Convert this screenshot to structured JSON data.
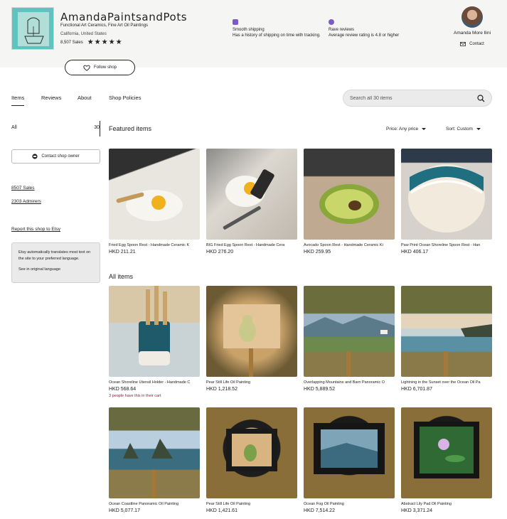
{
  "shop": {
    "name": "AmandaPaintsandPots",
    "tagline": "Functional Art Ceramics, Fine Art Oil Paintings",
    "location": "California, United States",
    "sales": "8,507 Sales",
    "rating": 5
  },
  "features": [
    {
      "title": "Smooth shipping",
      "desc": "Has a history of shipping on time with tracking.",
      "icon": "shipping-truck-icon"
    },
    {
      "title": "Rave reviews",
      "desc": "Average review rating is 4.8 or higher",
      "icon": "rave-badge-icon"
    }
  ],
  "owner": {
    "name": "Amanda More llini",
    "contact_label": "Contact"
  },
  "follow_label": "Follow shop",
  "tabs": [
    {
      "label": "Items",
      "active": true
    },
    {
      "label": "Reviews",
      "active": false
    },
    {
      "label": "About",
      "active": false
    },
    {
      "label": "Shop Policies",
      "active": false
    }
  ],
  "search": {
    "placeholder": "Search all 30 items"
  },
  "sidebar": {
    "all_label": "All",
    "all_count": "30",
    "contact_owner_label": "Contact shop owner",
    "sales_link": "8507 Sales",
    "admirers_link": "2303 Admirers",
    "report_link": "Report this shop to Etsy",
    "translate_text": "Etsy automatically translates most text on the site to your preferred language.",
    "see_original": "See in original language"
  },
  "featured": {
    "title": "Featured items",
    "price_filter": "Price: Any price",
    "sort_filter": "Sort: Custom",
    "items": [
      {
        "title": "Fried Egg Spoon Rest - Handmade Ceramic K",
        "price": "HKD 211.21"
      },
      {
        "title": "BIG Fried Egg Spoon Rest - Handmade Cera",
        "price": "HKD 276.20"
      },
      {
        "title": "Avocado Spoon Rest - Handmade Ceramic Ki",
        "price": "HKD 259.95"
      },
      {
        "title": "Paw Print Ocean Shoreline Spoon Rest - Han",
        "price": "HKD 406.17"
      }
    ]
  },
  "all_items": {
    "title": "All items",
    "items": [
      {
        "title": "Ocean Shoreline Utensil Holder - Handmade C",
        "price": "HKD 568.64",
        "note": "3 people have this in their cart"
      },
      {
        "title": "Pear Still Life Oil Painting",
        "price": "HKD 1,218.52",
        "note": ""
      },
      {
        "title": "Overlapping Mountains and Barn Panoramic O",
        "price": "HKD 5,889.52",
        "note": ""
      },
      {
        "title": "Lightning in the Sunset over the Ocean Oil Pa",
        "price": "HKD 6,701.87",
        "note": ""
      },
      {
        "title": "Ocean Coastline Panoramic Oil Painting",
        "price": "HKD 5,077.17",
        "note": ""
      },
      {
        "title": "Pear Still Life Oil Painting",
        "price": "HKD 1,421.61",
        "note": ""
      },
      {
        "title": "Ocean Fog Oil Painting",
        "price": "HKD 7,514.22",
        "note": ""
      },
      {
        "title": "Abstract Lily Pad Oil Painting",
        "price": "HKD 3,371.24",
        "note": ""
      }
    ]
  },
  "colors": {
    "accent": "#222222",
    "cart_note": "#a0173a",
    "header_bg": "#f5f5f3"
  }
}
